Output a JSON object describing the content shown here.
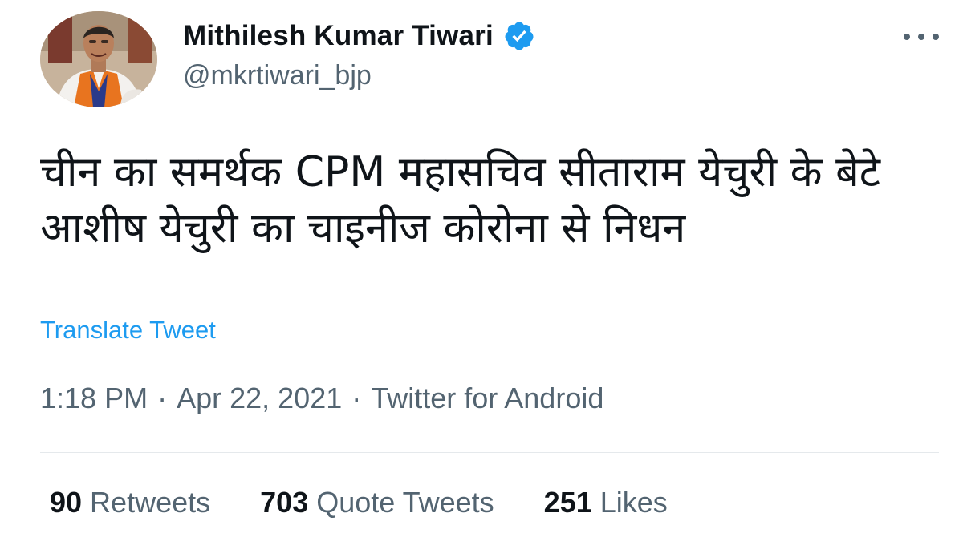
{
  "author": {
    "display_name": "Mithilesh Kumar Tiwari",
    "handle": "@mkrtiwari_bjp",
    "verified": true
  },
  "tweet": {
    "text": "चीन का समर्थक CPM महासचिव सीताराम येचुरी के बेटे आशीष येचुरी का चाइनीज कोरोना से निधन",
    "translate_label": "Translate Tweet",
    "time": "1:18 PM",
    "separator": "·",
    "date": "Apr 22, 2021",
    "source": "Twitter for Android"
  },
  "stats": {
    "retweets": {
      "count": "90",
      "label": "Retweets"
    },
    "quote_tweets": {
      "count": "703",
      "label": "Quote Tweets"
    },
    "likes": {
      "count": "251",
      "label": "Likes"
    }
  },
  "icons": {
    "verified": "verified-badge-icon",
    "more": "more-options-icon"
  },
  "colors": {
    "link": "#1d9bf0",
    "secondary_text": "#536471",
    "primary_text": "#0f1419",
    "verified": "#1d9bf0"
  }
}
